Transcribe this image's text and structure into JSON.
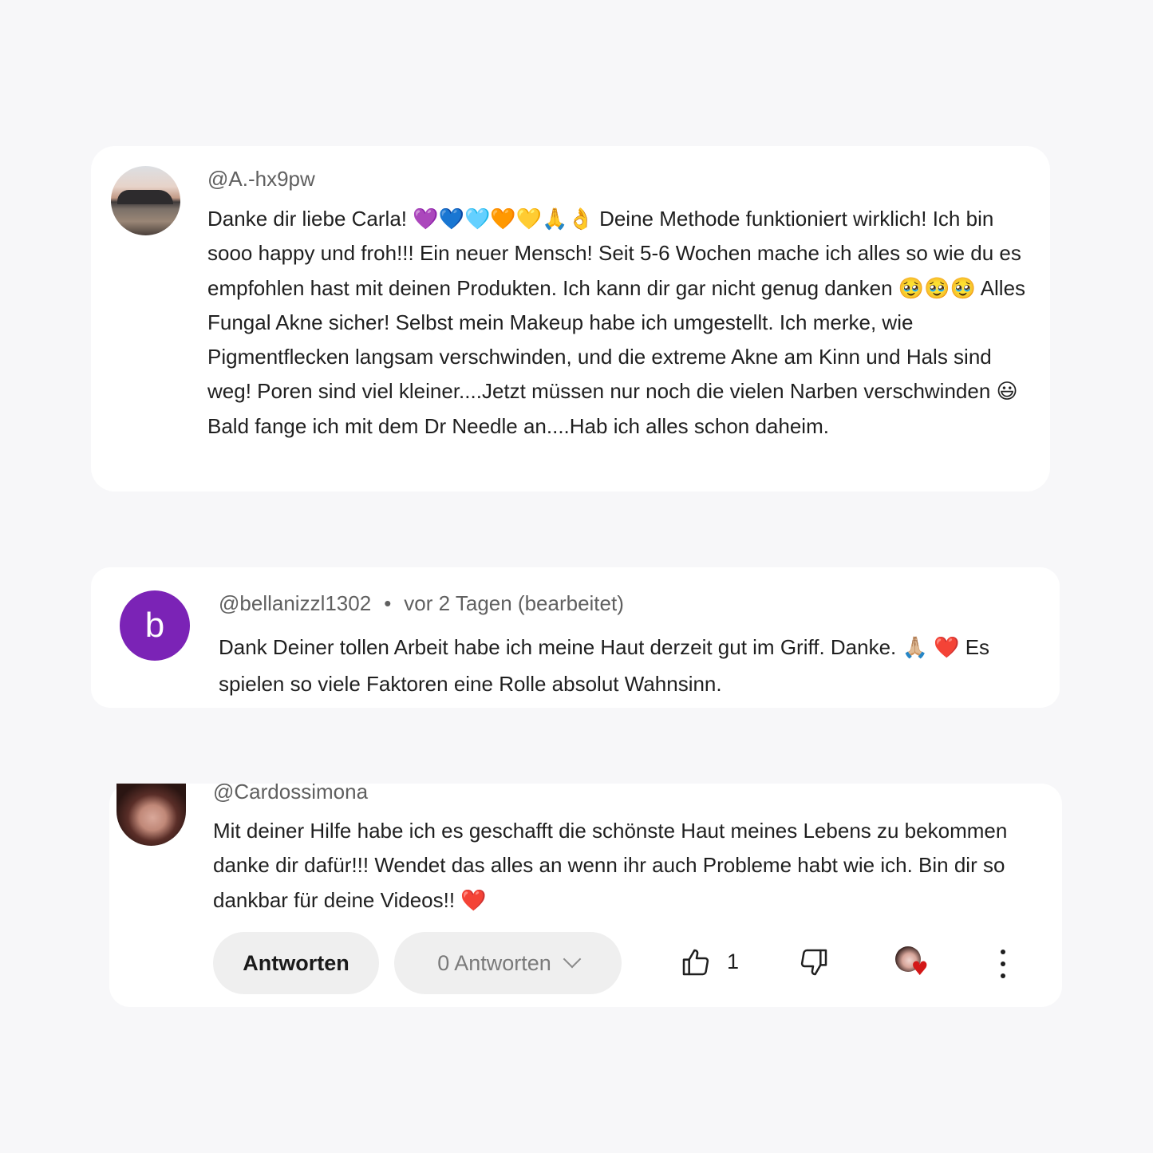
{
  "comments": [
    {
      "username": "@A.-hx9pw",
      "avatar_icon": "sunset-lake-avatar",
      "text": "Danke dir liebe Carla! 💜💙🩵🧡💛🙏👌 Deine Methode funktioniert wirklich! Ich bin sooo happy und froh!!! Ein neuer Mensch! Seit 5-6 Wochen mache ich alles so wie du es empfohlen hast mit deinen Produkten. Ich kann dir gar nicht genug danken 🥹🥹🥹 Alles Fungal Akne sicher! Selbst mein Makeup habe ich umgestellt. Ich merke, wie Pigmentflecken  langsam verschwinden, und die extreme Akne am Kinn und Hals sind weg! Poren sind viel kleiner....Jetzt müssen nur noch die vielen Narben verschwinden 😃 Bald fange ich mit dem Dr Needle an....Hab ich alles schon daheim."
    },
    {
      "username": "@bellanizzl1302",
      "separator": "•",
      "timestamp": "vor 2 Tagen (bearbeitet)",
      "avatar_letter": "b",
      "avatar_color": "#7b23b6",
      "text": "Dank Deiner tollen Arbeit habe ich meine Haut derzeit gut im Griff. Danke. 🙏🏼 ❤️ Es spielen so viele Faktoren eine Rolle absolut Wahnsinn."
    },
    {
      "username": "@Cardossimona",
      "avatar_icon": "portrait-avatar",
      "text": "Mit deiner Hilfe habe ich es geschafft die schönste Haut meines Lebens zu bekommen danke dir dafür!!! Wendet das alles an wenn ihr auch Probleme habt wie ich. Bin dir so dankbar für deine Videos!! ❤️",
      "actions": {
        "reply_label": "Antworten",
        "replies_label": "0 Antworten",
        "like_count": "1",
        "heart_color": "#d31717"
      }
    }
  ]
}
